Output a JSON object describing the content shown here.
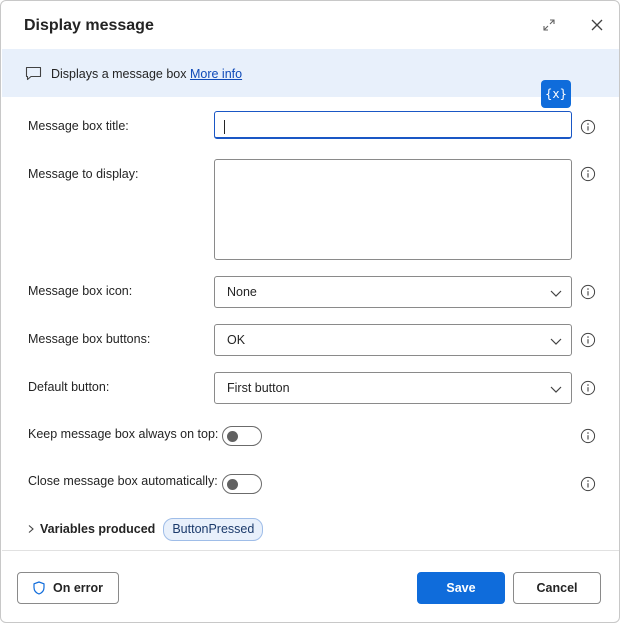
{
  "dialog": {
    "title": "Display message",
    "expand_icon": "expand-icon",
    "close_icon": "close-icon"
  },
  "info_bar": {
    "icon": "message-icon",
    "text": "Displays a message box",
    "link": "More info"
  },
  "variables_button": {
    "label": "{x}"
  },
  "fields": {
    "title": {
      "label": "Message box title:",
      "value": ""
    },
    "message": {
      "label": "Message to display:",
      "value": ""
    },
    "icon": {
      "label": "Message box icon:",
      "value": "None"
    },
    "buttons": {
      "label": "Message box buttons:",
      "value": "OK"
    },
    "default_button": {
      "label": "Default button:",
      "value": "First button"
    },
    "always_on_top": {
      "label": "Keep message box always on top:",
      "checked": false
    },
    "auto_close": {
      "label": "Close message box automatically:",
      "checked": false
    }
  },
  "variables_produced": {
    "label": "Variables produced",
    "items": [
      "ButtonPressed"
    ]
  },
  "footer": {
    "on_error": "On error",
    "save": "Save",
    "cancel": "Cancel"
  },
  "colors": {
    "accent": "#0f6cdb",
    "info_bar_bg": "#e8f0fb",
    "link": "#0f4ab8"
  }
}
